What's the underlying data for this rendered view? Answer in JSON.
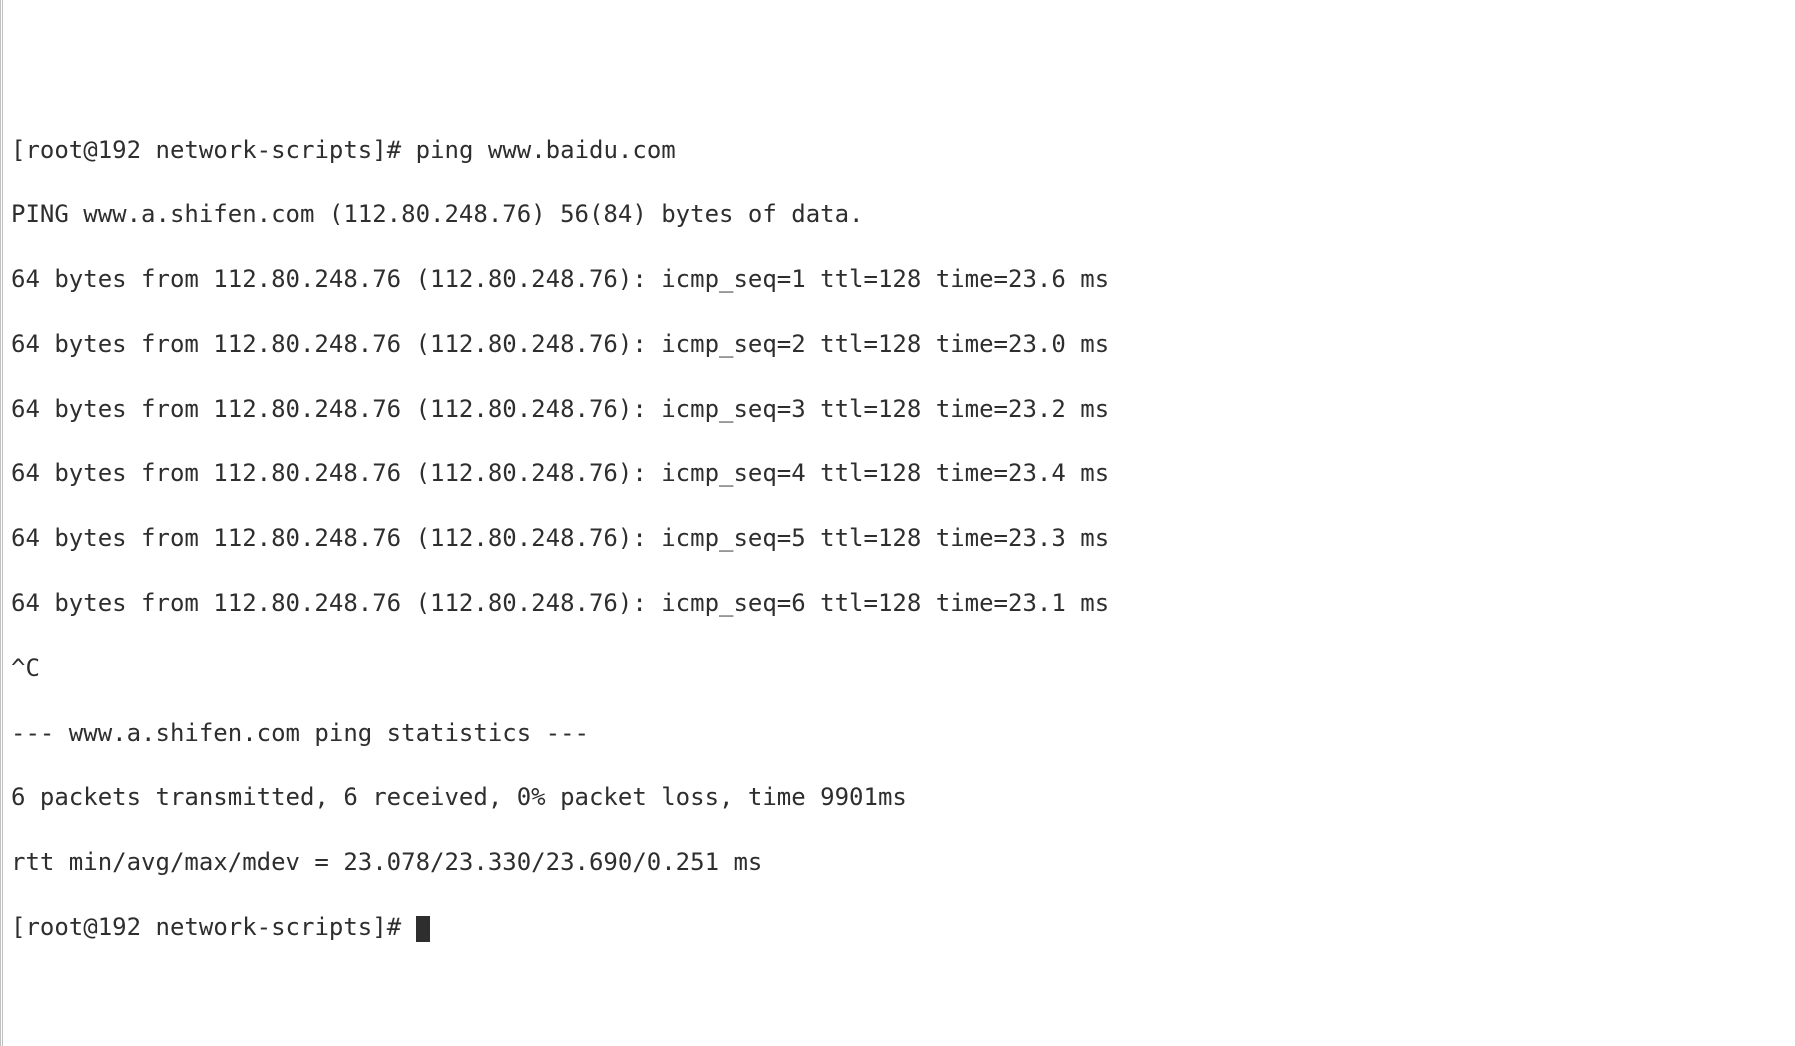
{
  "prompt": {
    "open": "[",
    "user": "root",
    "at": "@",
    "host": "192",
    "space": " ",
    "cwd": "network-scripts",
    "close": "]",
    "hash": "# "
  },
  "command": {
    "name": "ping",
    "arg": "www.baidu.com"
  },
  "ping_header": "PING www.a.shifen.com (112.80.248.76) 56(84) bytes of data.",
  "replies": [
    "64 bytes from 112.80.248.76 (112.80.248.76): icmp_seq=1 ttl=128 time=23.6 ms",
    "64 bytes from 112.80.248.76 (112.80.248.76): icmp_seq=2 ttl=128 time=23.0 ms",
    "64 bytes from 112.80.248.76 (112.80.248.76): icmp_seq=3 ttl=128 time=23.2 ms",
    "64 bytes from 112.80.248.76 (112.80.248.76): icmp_seq=4 ttl=128 time=23.4 ms",
    "64 bytes from 112.80.248.76 (112.80.248.76): icmp_seq=5 ttl=128 time=23.3 ms",
    "64 bytes from 112.80.248.76 (112.80.248.76): icmp_seq=6 ttl=128 time=23.1 ms"
  ],
  "interrupt": "^C",
  "stats_header": "--- www.a.shifen.com ping statistics ---",
  "stats_summary": "6 packets transmitted, 6 received, 0% packet loss, time 9901ms",
  "rtt_line": "rtt min/avg/max/mdev = 23.078/23.330/23.690/0.251 ms"
}
